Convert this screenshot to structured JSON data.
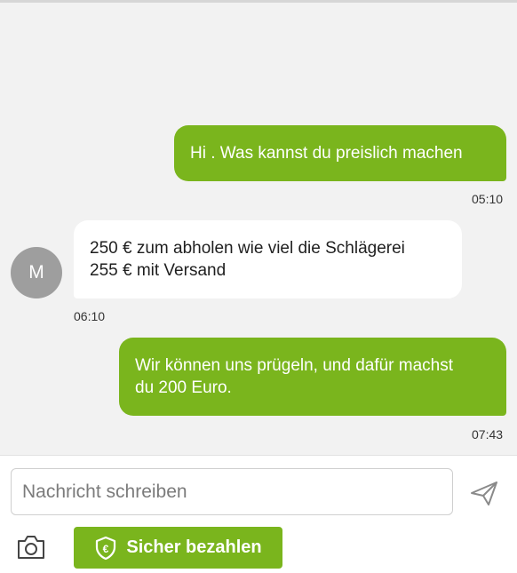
{
  "messages": [
    {
      "direction": "outgoing",
      "lines": [
        "Hi . Was kannst du preislich machen"
      ],
      "time": "05:10"
    },
    {
      "direction": "incoming",
      "avatar_initial": "M",
      "lines": [
        "250 € zum abholen wie viel die Schlägerei",
        "255 € mit Versand"
      ],
      "time": "06:10"
    },
    {
      "direction": "outgoing",
      "lines": [
        "Wir können uns prügeln, und dafür machst",
        "du 200 Euro."
      ],
      "time": "07:43"
    }
  ],
  "composer": {
    "placeholder": "Nachricht schreiben",
    "send_icon": "send-icon",
    "camera_icon": "camera-icon",
    "pay_label": "Sicher bezahlen",
    "pay_icon": "euro-shield-icon"
  },
  "colors": {
    "accent": "#7ab51d",
    "background": "#f2f2f2",
    "incoming_bubble": "#ffffff",
    "avatar": "#9e9e9e"
  }
}
